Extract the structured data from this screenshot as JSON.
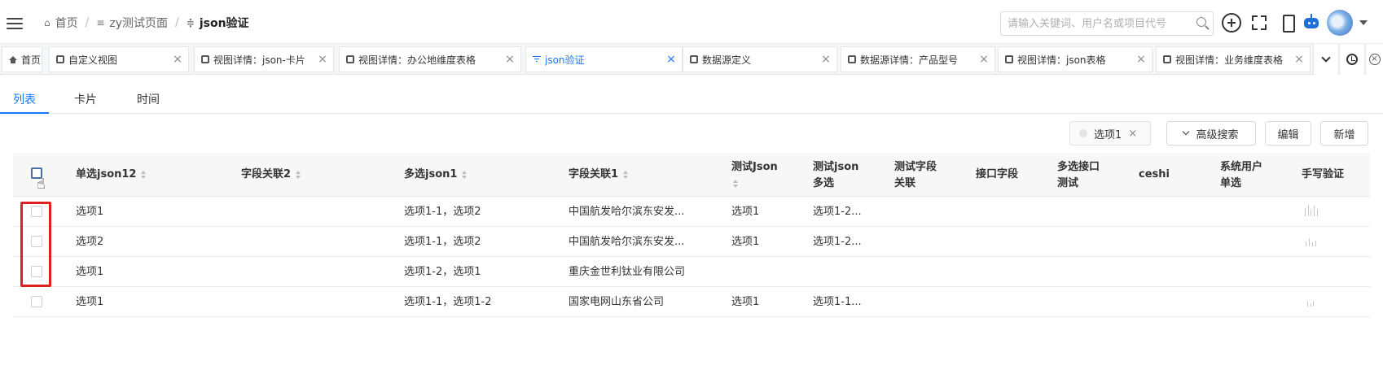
{
  "header": {
    "breadcrumbs": [
      {
        "label": "首页",
        "icon": "home-icon"
      },
      {
        "label": "zy测试页面",
        "icon": "list-icon"
      },
      {
        "label": "json验证",
        "icon": "filter-icon"
      }
    ],
    "search_placeholder": "请输入关键词、用户名或项目代号"
  },
  "tabs": [
    {
      "label": "首页",
      "icon": "home-icon"
    },
    {
      "label": "自定义视图",
      "icon": "view-icon"
    },
    {
      "label": "视图详情：json-卡片",
      "icon": "view-icon"
    },
    {
      "label": "视图详情：办公地维度表格",
      "icon": "view-icon"
    },
    {
      "label": "json验证",
      "icon": "filter-icon",
      "active": true
    },
    {
      "label": "数据源定义",
      "icon": "view-icon"
    },
    {
      "label": "数据源详情：产品型号",
      "icon": "view-icon"
    },
    {
      "label": "视图详情：json表格",
      "icon": "view-icon"
    },
    {
      "label": "视图详情：业务维度表格",
      "icon": "view-icon"
    }
  ],
  "page_tabs": [
    "列表",
    "卡片",
    "时间"
  ],
  "toolbar": {
    "filter_chip": "选项1",
    "advanced_search": "高级搜索",
    "edit": "编辑",
    "add": "新增"
  },
  "table": {
    "columns": [
      {
        "label": "单选json12",
        "sortable": true
      },
      {
        "label": "字段关联2",
        "sortable": true
      },
      {
        "label": "多选json1",
        "sortable": true
      },
      {
        "label": "字段关联1",
        "sortable": true
      },
      {
        "label": "测试Json",
        "sortable": true
      },
      {
        "label": "测试json多选",
        "sortable": false
      },
      {
        "label": "测试字段关联",
        "sortable": false
      },
      {
        "label": "接口字段",
        "sortable": false
      },
      {
        "label": "多选接口测试",
        "sortable": false
      },
      {
        "label": "ceshi",
        "sortable": false
      },
      {
        "label": "系统用户单选",
        "sortable": false
      },
      {
        "label": "手写验证",
        "sortable": false
      }
    ],
    "rows": [
      [
        "选项1",
        "",
        "选项1-1，选项2",
        "中国航发哈尔滨东安发...",
        "选项1",
        "选项1-2...",
        "",
        "",
        "",
        "",
        "",
        "signature"
      ],
      [
        "选项2",
        "",
        "选项1-1，选项2",
        "中国航发哈尔滨东安发...",
        "选项1",
        "选项1-2...",
        "",
        "",
        "",
        "",
        "",
        "signature"
      ],
      [
        "选项1",
        "",
        "选项1-2，选项1",
        "重庆金世利钛业有限公司",
        "",
        "",
        "",
        "",
        "",
        "",
        "",
        ""
      ],
      [
        "选项1",
        "",
        "选项1-1，选项1-2",
        "国家电网山东省公司",
        "选项1",
        "选项1-1...",
        "",
        "",
        "",
        "",
        "",
        "signature"
      ]
    ]
  }
}
